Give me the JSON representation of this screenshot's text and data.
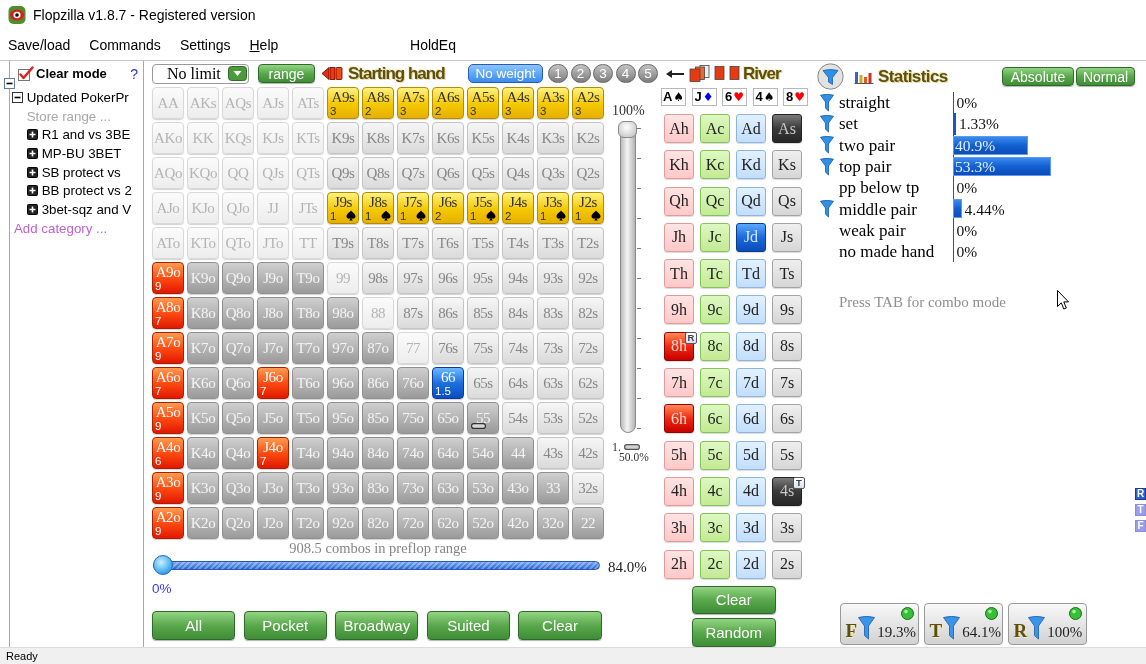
{
  "window": {
    "title": "Flopzilla v1.8.7 - Registered version"
  },
  "menu": [
    {
      "label": "Save/load",
      "mnemonic": false
    },
    {
      "label": "Commands",
      "mnemonic": false
    },
    {
      "label": "Settings",
      "mnemonic": false
    },
    {
      "label": "Help",
      "mnemonic": true
    },
    {
      "label": "HoldEq",
      "mnemonic": false
    }
  ],
  "range_panel": {
    "expanded": true,
    "clear_mode": {
      "label": "Clear mode",
      "checked": true
    },
    "help": "?",
    "tree": [
      {
        "label": "Updated PokerPr",
        "kind": "group",
        "expanded": true,
        "children": [
          {
            "label": "Store range ...",
            "kind": "action"
          },
          {
            "label": "R1 and vs 3BE",
            "kind": "group",
            "expanded": false
          },
          {
            "label": "MP-BU 3BET",
            "kind": "group",
            "expanded": false
          },
          {
            "label": "SB protect vs",
            "kind": "group",
            "expanded": false
          },
          {
            "label": "BB protect vs 2",
            "kind": "group",
            "expanded": false
          },
          {
            "label": "3bet-sqz and V",
            "kind": "group",
            "expanded": false
          }
        ]
      }
    ],
    "add_category": "Add category ..."
  },
  "preflop": {
    "game": {
      "value": "No limit"
    },
    "range_button": "range",
    "title": "Starting hand",
    "weights": [
      {
        "label": "No weight",
        "selected": true
      },
      {
        "label": "1",
        "selected": false
      },
      {
        "label": "2",
        "selected": false
      },
      {
        "label": "3",
        "selected": false
      },
      {
        "label": "4",
        "selected": false
      },
      {
        "label": "5",
        "selected": false
      }
    ],
    "rows": [
      [
        {
          "hand": "AA",
          "kind": "pale"
        },
        {
          "hand": "AKs",
          "kind": "pale"
        },
        {
          "hand": "AQs",
          "kind": "pale"
        },
        {
          "hand": "AJs",
          "kind": "pale"
        },
        {
          "hand": "ATs",
          "kind": "pale"
        },
        {
          "hand": "A9s",
          "kind": "gold",
          "count": "3"
        },
        {
          "hand": "A8s",
          "kind": "gold",
          "count": "2"
        },
        {
          "hand": "A7s",
          "kind": "gold",
          "count": "3"
        },
        {
          "hand": "A6s",
          "kind": "gold",
          "count": "2"
        },
        {
          "hand": "A5s",
          "kind": "gold",
          "count": "3"
        },
        {
          "hand": "A4s",
          "kind": "gold",
          "count": "3"
        },
        {
          "hand": "A3s",
          "kind": "gold",
          "count": "3"
        },
        {
          "hand": "A2s",
          "kind": "gold",
          "count": "3"
        }
      ],
      [
        {
          "hand": "AKo",
          "kind": "pale"
        },
        {
          "hand": "KK",
          "kind": "pale"
        },
        {
          "hand": "KQs",
          "kind": "pale"
        },
        {
          "hand": "KJs",
          "kind": "pale"
        },
        {
          "hand": "KTs",
          "kind": "pale"
        },
        {
          "hand": "K9s",
          "kind": "light"
        },
        {
          "hand": "K8s",
          "kind": "light"
        },
        {
          "hand": "K7s",
          "kind": "light"
        },
        {
          "hand": "K6s",
          "kind": "light"
        },
        {
          "hand": "K5s",
          "kind": "light"
        },
        {
          "hand": "K4s",
          "kind": "light"
        },
        {
          "hand": "K3s",
          "kind": "light"
        },
        {
          "hand": "K2s",
          "kind": "light"
        }
      ],
      [
        {
          "hand": "AQo",
          "kind": "pale"
        },
        {
          "hand": "KQo",
          "kind": "pale"
        },
        {
          "hand": "QQ",
          "kind": "pale"
        },
        {
          "hand": "QJs",
          "kind": "pale"
        },
        {
          "hand": "QTs",
          "kind": "pale"
        },
        {
          "hand": "Q9s",
          "kind": "light"
        },
        {
          "hand": "Q8s",
          "kind": "light"
        },
        {
          "hand": "Q7s",
          "kind": "light"
        },
        {
          "hand": "Q6s",
          "kind": "light"
        },
        {
          "hand": "Q5s",
          "kind": "light"
        },
        {
          "hand": "Q4s",
          "kind": "light"
        },
        {
          "hand": "Q3s",
          "kind": "light"
        },
        {
          "hand": "Q2s",
          "kind": "light"
        }
      ],
      [
        {
          "hand": "AJo",
          "kind": "pale"
        },
        {
          "hand": "KJo",
          "kind": "pale"
        },
        {
          "hand": "QJo",
          "kind": "pale"
        },
        {
          "hand": "JJ",
          "kind": "pale"
        },
        {
          "hand": "JTs",
          "kind": "pale"
        },
        {
          "hand": "J9s",
          "kind": "gold",
          "count": "1",
          "symbol": {
            "kind": "spade"
          }
        },
        {
          "hand": "J8s",
          "kind": "gold",
          "count": "1",
          "symbol": {
            "kind": "spade"
          }
        },
        {
          "hand": "J7s",
          "kind": "gold",
          "count": "1",
          "symbol": {
            "kind": "spade"
          }
        },
        {
          "hand": "J6s",
          "kind": "gold",
          "count": "2"
        },
        {
          "hand": "J5s",
          "kind": "gold",
          "count": "1",
          "symbol": {
            "kind": "spade"
          }
        },
        {
          "hand": "J4s",
          "kind": "gold",
          "count": "2"
        },
        {
          "hand": "J3s",
          "kind": "gold",
          "count": "1",
          "symbol": {
            "kind": "spade"
          }
        },
        {
          "hand": "J2s",
          "kind": "gold",
          "count": "1",
          "symbol": {
            "kind": "spade"
          }
        }
      ],
      [
        {
          "hand": "ATo",
          "kind": "pale"
        },
        {
          "hand": "KTo",
          "kind": "pale"
        },
        {
          "hand": "QTo",
          "kind": "pale"
        },
        {
          "hand": "JTo",
          "kind": "pale"
        },
        {
          "hand": "TT",
          "kind": "pale"
        },
        {
          "hand": "T9s",
          "kind": "light"
        },
        {
          "hand": "T8s",
          "kind": "light"
        },
        {
          "hand": "T7s",
          "kind": "light"
        },
        {
          "hand": "T6s",
          "kind": "light"
        },
        {
          "hand": "T5s",
          "kind": "light"
        },
        {
          "hand": "T4s",
          "kind": "light"
        },
        {
          "hand": "T3s",
          "kind": "light"
        },
        {
          "hand": "T2s",
          "kind": "light"
        }
      ],
      [
        {
          "hand": "A9o",
          "kind": "red",
          "count": "9"
        },
        {
          "hand": "K9o",
          "kind": "dark"
        },
        {
          "hand": "Q9o",
          "kind": "dark"
        },
        {
          "hand": "J9o",
          "kind": "dark"
        },
        {
          "hand": "T9o",
          "kind": "dark"
        },
        {
          "hand": "99",
          "kind": "pale"
        },
        {
          "hand": "98s",
          "kind": "light"
        },
        {
          "hand": "97s",
          "kind": "light"
        },
        {
          "hand": "96s",
          "kind": "light"
        },
        {
          "hand": "95s",
          "kind": "light"
        },
        {
          "hand": "94s",
          "kind": "light"
        },
        {
          "hand": "93s",
          "kind": "light"
        },
        {
          "hand": "92s",
          "kind": "light"
        }
      ],
      [
        {
          "hand": "A8o",
          "kind": "red",
          "count": "7"
        },
        {
          "hand": "K8o",
          "kind": "dark"
        },
        {
          "hand": "Q8o",
          "kind": "dark"
        },
        {
          "hand": "J8o",
          "kind": "dark"
        },
        {
          "hand": "T8o",
          "kind": "dark"
        },
        {
          "hand": "98o",
          "kind": "dark"
        },
        {
          "hand": "88",
          "kind": "pale"
        },
        {
          "hand": "87s",
          "kind": "light"
        },
        {
          "hand": "86s",
          "kind": "light"
        },
        {
          "hand": "85s",
          "kind": "light"
        },
        {
          "hand": "84s",
          "kind": "light"
        },
        {
          "hand": "83s",
          "kind": "light"
        },
        {
          "hand": "82s",
          "kind": "light"
        }
      ],
      [
        {
          "hand": "A7o",
          "kind": "red",
          "count": "9"
        },
        {
          "hand": "K7o",
          "kind": "dark"
        },
        {
          "hand": "Q7o",
          "kind": "dark"
        },
        {
          "hand": "J7o",
          "kind": "dark"
        },
        {
          "hand": "T7o",
          "kind": "dark"
        },
        {
          "hand": "97o",
          "kind": "dark"
        },
        {
          "hand": "87o",
          "kind": "dark"
        },
        {
          "hand": "77",
          "kind": "pale"
        },
        {
          "hand": "76s",
          "kind": "light"
        },
        {
          "hand": "75s",
          "kind": "light"
        },
        {
          "hand": "74s",
          "kind": "light"
        },
        {
          "hand": "73s",
          "kind": "light"
        },
        {
          "hand": "72s",
          "kind": "light"
        }
      ],
      [
        {
          "hand": "A6o",
          "kind": "red",
          "count": "7"
        },
        {
          "hand": "K6o",
          "kind": "dark"
        },
        {
          "hand": "Q6o",
          "kind": "dark"
        },
        {
          "hand": "J6o",
          "kind": "red",
          "count": "7"
        },
        {
          "hand": "T6o",
          "kind": "dark"
        },
        {
          "hand": "96o",
          "kind": "dark"
        },
        {
          "hand": "86o",
          "kind": "dark"
        },
        {
          "hand": "76o",
          "kind": "dark"
        },
        {
          "hand": "66",
          "kind": "blue",
          "count": "1.5"
        },
        {
          "hand": "65s",
          "kind": "light"
        },
        {
          "hand": "64s",
          "kind": "light"
        },
        {
          "hand": "63s",
          "kind": "light"
        },
        {
          "hand": "62s",
          "kind": "light"
        }
      ],
      [
        {
          "hand": "A5o",
          "kind": "red",
          "count": "9"
        },
        {
          "hand": "K5o",
          "kind": "dark"
        },
        {
          "hand": "Q5o",
          "kind": "dark"
        },
        {
          "hand": "J5o",
          "kind": "dark"
        },
        {
          "hand": "T5o",
          "kind": "dark"
        },
        {
          "hand": "95o",
          "kind": "dark"
        },
        {
          "hand": "85o",
          "kind": "dark"
        },
        {
          "hand": "75o",
          "kind": "dark"
        },
        {
          "hand": "65o",
          "kind": "dark"
        },
        {
          "hand": "55",
          "kind": "dark",
          "symbol": {
            "kind": "handle"
          }
        },
        {
          "hand": "54s",
          "kind": "light"
        },
        {
          "hand": "53s",
          "kind": "light"
        },
        {
          "hand": "52s",
          "kind": "light"
        }
      ],
      [
        {
          "hand": "A4o",
          "kind": "red",
          "count": "6"
        },
        {
          "hand": "K4o",
          "kind": "dark"
        },
        {
          "hand": "Q4o",
          "kind": "dark"
        },
        {
          "hand": "J4o",
          "kind": "red",
          "count": "7"
        },
        {
          "hand": "T4o",
          "kind": "dark"
        },
        {
          "hand": "94o",
          "kind": "dark"
        },
        {
          "hand": "84o",
          "kind": "dark"
        },
        {
          "hand": "74o",
          "kind": "dark"
        },
        {
          "hand": "64o",
          "kind": "dark"
        },
        {
          "hand": "54o",
          "kind": "dark"
        },
        {
          "hand": "44",
          "kind": "dark"
        },
        {
          "hand": "43s",
          "kind": "light"
        },
        {
          "hand": "42s",
          "kind": "light"
        }
      ],
      [
        {
          "hand": "A3o",
          "kind": "red",
          "count": "9"
        },
        {
          "hand": "K3o",
          "kind": "dark"
        },
        {
          "hand": "Q3o",
          "kind": "dark"
        },
        {
          "hand": "J3o",
          "kind": "dark"
        },
        {
          "hand": "T3o",
          "kind": "dark"
        },
        {
          "hand": "93o",
          "kind": "dark"
        },
        {
          "hand": "83o",
          "kind": "dark"
        },
        {
          "hand": "73o",
          "kind": "dark"
        },
        {
          "hand": "63o",
          "kind": "dark"
        },
        {
          "hand": "53o",
          "kind": "dark"
        },
        {
          "hand": "43o",
          "kind": "dark"
        },
        {
          "hand": "33",
          "kind": "dark"
        },
        {
          "hand": "32s",
          "kind": "light"
        }
      ],
      [
        {
          "hand": "A2o",
          "kind": "red",
          "count": "9"
        },
        {
          "hand": "K2o",
          "kind": "dark"
        },
        {
          "hand": "Q2o",
          "kind": "dark"
        },
        {
          "hand": "J2o",
          "kind": "dark"
        },
        {
          "hand": "T2o",
          "kind": "dark"
        },
        {
          "hand": "92o",
          "kind": "dark"
        },
        {
          "hand": "82o",
          "kind": "dark"
        },
        {
          "hand": "72o",
          "kind": "dark"
        },
        {
          "hand": "62o",
          "kind": "dark"
        },
        {
          "hand": "52o",
          "kind": "dark"
        },
        {
          "hand": "42o",
          "kind": "dark"
        },
        {
          "hand": "32o",
          "kind": "dark"
        },
        {
          "hand": "22",
          "kind": "dark"
        }
      ]
    ],
    "weight_slider": {
      "label": "100%",
      "level": 1,
      "handle_label": "1.",
      "reading": "50.0%"
    },
    "combos": "908.5 combos in preflop range",
    "range_slider": {
      "level": 0,
      "reading": "84.0%",
      "min_label": "0%"
    },
    "buttons": [
      "All",
      "Pocket",
      "Broadway",
      "Suited",
      "Clear"
    ]
  },
  "board": {
    "title": "River",
    "cards": [
      {
        "rank": "A",
        "suit": "♠",
        "color": "#000000"
      },
      {
        "rank": "J",
        "suit": "♦",
        "color": "#0000ff"
      },
      {
        "rank": "6",
        "suit": "♥",
        "color": "#ff0000"
      },
      {
        "rank": "4",
        "suit": "♠",
        "color": "#000000"
      },
      {
        "rank": "8",
        "suit": "♥",
        "color": "#ff0000"
      }
    ],
    "deck": [
      [
        {
          "label": "Ah",
          "selected": false
        },
        {
          "label": "Ac",
          "selected": false
        },
        {
          "label": "Ad",
          "selected": false
        },
        {
          "label": "As",
          "selected": true
        }
      ],
      [
        {
          "label": "Kh",
          "selected": false
        },
        {
          "label": "Kc",
          "selected": false
        },
        {
          "label": "Kd",
          "selected": false
        },
        {
          "label": "Ks",
          "selected": false
        }
      ],
      [
        {
          "label": "Qh",
          "selected": false
        },
        {
          "label": "Qc",
          "selected": false
        },
        {
          "label": "Qd",
          "selected": false
        },
        {
          "label": "Qs",
          "selected": false
        }
      ],
      [
        {
          "label": "Jh",
          "selected": false
        },
        {
          "label": "Jc",
          "selected": false
        },
        {
          "label": "Jd",
          "selected": true
        },
        {
          "label": "Js",
          "selected": false
        }
      ],
      [
        {
          "label": "Th",
          "selected": false
        },
        {
          "label": "Tc",
          "selected": false
        },
        {
          "label": "Td",
          "selected": false
        },
        {
          "label": "Ts",
          "selected": false
        }
      ],
      [
        {
          "label": "9h",
          "selected": false
        },
        {
          "label": "9c",
          "selected": false
        },
        {
          "label": "9d",
          "selected": false
        },
        {
          "label": "9s",
          "selected": false
        }
      ],
      [
        {
          "label": "8h",
          "selected": true,
          "badge": "R"
        },
        {
          "label": "8c",
          "selected": false
        },
        {
          "label": "8d",
          "selected": false
        },
        {
          "label": "8s",
          "selected": false
        }
      ],
      [
        {
          "label": "7h",
          "selected": false
        },
        {
          "label": "7c",
          "selected": false
        },
        {
          "label": "7d",
          "selected": false
        },
        {
          "label": "7s",
          "selected": false
        }
      ],
      [
        {
          "label": "6h",
          "selected": true
        },
        {
          "label": "6c",
          "selected": false
        },
        {
          "label": "6d",
          "selected": false
        },
        {
          "label": "6s",
          "selected": false
        }
      ],
      [
        {
          "label": "5h",
          "selected": false
        },
        {
          "label": "5c",
          "selected": false
        },
        {
          "label": "5d",
          "selected": false
        },
        {
          "label": "5s",
          "selected": false
        }
      ],
      [
        {
          "label": "4h",
          "selected": false
        },
        {
          "label": "4c",
          "selected": false
        },
        {
          "label": "4d",
          "selected": false
        },
        {
          "label": "4s",
          "selected": true,
          "badge": "T"
        }
      ],
      [
        {
          "label": "3h",
          "selected": false
        },
        {
          "label": "3c",
          "selected": false
        },
        {
          "label": "3d",
          "selected": false
        },
        {
          "label": "3s",
          "selected": false
        }
      ],
      [
        {
          "label": "2h",
          "selected": false
        },
        {
          "label": "2c",
          "selected": false
        },
        {
          "label": "2d",
          "selected": false
        },
        {
          "label": "2s",
          "selected": false
        }
      ]
    ],
    "buttons": [
      "Clear",
      "Random"
    ]
  },
  "statistics": {
    "title": "Statistics",
    "buttons": [
      "Absolute",
      "Normal"
    ],
    "rows": [
      {
        "label": "straight",
        "filter": true,
        "level": 0,
        "reading": "0%"
      },
      {
        "label": "set",
        "filter": true,
        "level": 0.0133,
        "reading": "1.33%"
      },
      {
        "label": "two pair",
        "filter": true,
        "level": 0.409,
        "reading": "40.9%"
      },
      {
        "label": "top pair",
        "filter": true,
        "level": 0.533,
        "reading": "53.3%"
      },
      {
        "label": "pp below tp",
        "filter": false,
        "level": 0,
        "reading": "0%"
      },
      {
        "label": "middle pair",
        "filter": true,
        "level": 0.0444,
        "reading": "4.44%"
      },
      {
        "label": "weak pair",
        "filter": false,
        "level": 0,
        "reading": "0%"
      },
      {
        "label": "no made hand",
        "filter": false,
        "level": 0,
        "reading": "0%"
      }
    ],
    "hint": "Press TAB for combo mode",
    "side_tabs": [
      {
        "label": "R",
        "selected": true
      },
      {
        "label": "T",
        "selected": false
      },
      {
        "label": "F",
        "selected": false
      }
    ],
    "filters": [
      {
        "letter": "F",
        "reading": "19.3%",
        "on": true
      },
      {
        "letter": "T",
        "reading": "64.1%",
        "on": true
      },
      {
        "letter": "R",
        "reading": "100%",
        "on": true
      }
    ]
  },
  "status_bar": {
    "text": "Ready"
  }
}
